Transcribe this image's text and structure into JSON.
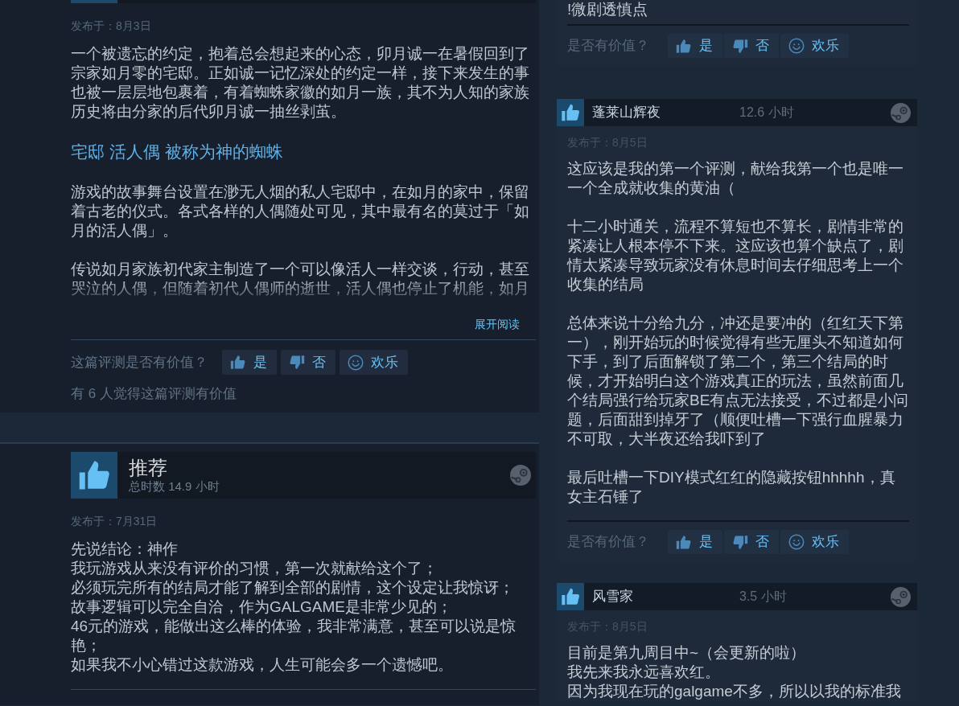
{
  "left_reviews": [
    {
      "posted": "发布于：8月3日",
      "body": [
        {
          "kind": "paragraph",
          "text": "一个被遗忘的约定，抱着总会想起来的心态，卯月诚一在暑假回到了宗家如月零的宅邸。正如诚一记忆深处的约定一样，接下来发生的事也被一层层地包裹着，有着蜘蛛家徽的如月一族，其不为人知的家族历史将由分家的后代卯月诚一抽丝剥茧。"
        },
        {
          "kind": "heading",
          "text": "宅邸 活人偶 被称为神的蜘蛛"
        },
        {
          "kind": "paragraph",
          "text": "游戏的故事舞台设置在渺无人烟的私人宅邸中，在如月的家中，保留着古老的仪式。各式各样的人偶随处可见，其中最有名的莫过于「如月的活人偶」。"
        },
        {
          "kind": "paragraph",
          "text": "传说如月家族初代家主制造了一个可以像活人一样交谈，行动，甚至哭泣的人偶，但随着初代人偶师的逝世，活人偶也停止了机能，如月"
        }
      ],
      "collapsed": true,
      "expand_link": "展开阅读",
      "helpful": {
        "question": "这篇评测是否有价值？",
        "buttons": [
          {
            "kind": "yes",
            "label": "是"
          },
          {
            "kind": "no",
            "label": "否"
          },
          {
            "kind": "funny",
            "label": "欢乐"
          }
        ]
      },
      "helpful_count": "有 6 人觉得这篇评测有价值"
    },
    {
      "recommended": true,
      "title": "推荐",
      "hours": "总时数 14.9 小时",
      "posted": "发布于：7月31日",
      "body": [
        {
          "kind": "paragraph",
          "text": "先说结论：神作"
        },
        {
          "kind": "line",
          "text": "我玩游戏从来没有评价的习惯，第一次就献给这个了；"
        },
        {
          "kind": "line",
          "text": "必须玩完所有的结局才能了解到全部的剧情，这个设定让我惊讶；"
        },
        {
          "kind": "line",
          "text": "故事逻辑可以完全自洽，作为GALGAME是非常少见的；"
        },
        {
          "kind": "line",
          "text": "46元的游戏，能做出这么棒的体验，我非常满意，甚至可以说是惊艳；"
        },
        {
          "kind": "line",
          "text": "如果我不小心错过这款游戏，人生可能会多一个遗憾吧。"
        }
      ]
    }
  ],
  "right_reviews": [
    {
      "body": [
        {
          "kind": "paragraph",
          "text": "!微剧透慎点"
        }
      ],
      "helpful": {
        "question": "是否有价值？",
        "buttons": [
          {
            "kind": "yes",
            "label": "是"
          },
          {
            "kind": "no",
            "label": "否"
          },
          {
            "kind": "funny",
            "label": "欢乐"
          }
        ]
      }
    },
    {
      "recommended": true,
      "author": "蓬莱山辉夜",
      "hours": "12.6 小时",
      "posted": "发布于：8月5日",
      "body": [
        {
          "kind": "paragraph",
          "text": "这应该是我的第一个评测，献给我第一个也是唯一一个全成就收集的黄油（"
        },
        {
          "kind": "paragraph",
          "text": "十二小时通关，流程不算短也不算长，剧情非常的紧凑让人根本停不下来。这应该也算个缺点了，剧情太紧凑导致玩家没有休息时间去仔细思考上一个收集的结局"
        },
        {
          "kind": "paragraph",
          "text": "总体来说十分给九分，冲还是要冲的（红红天下第一），刚开始玩的时候觉得有些无厘头不知道如何下手，到了后面解锁了第二个，第三个结局的时候，才开始明白这个游戏真正的玩法，虽然前面几个结局强行给玩家BE有点无法接受，不过都是小问题，后面甜到掉牙了（顺便吐槽一下强行血腥暴力不可取，大半夜还给我吓到了"
        },
        {
          "kind": "paragraph",
          "text": "最后吐槽一下DIY模式红红的隐藏按钮hhhhh，真女主石锤了"
        }
      ],
      "helpful": {
        "question": "是否有价值？",
        "buttons": [
          {
            "kind": "yes",
            "label": "是"
          },
          {
            "kind": "no",
            "label": "否"
          },
          {
            "kind": "funny",
            "label": "欢乐"
          }
        ]
      }
    },
    {
      "recommended": true,
      "author": "风雪家",
      "hours": "3.5 小时",
      "posted": "发布于：8月5日",
      "body": [
        {
          "kind": "paragraph",
          "text": "目前是第九周目中~（会更新的啦）"
        },
        {
          "kind": "line",
          "text": "我先来我永远喜欢红。"
        },
        {
          "kind": "line",
          "text": "因为我现在玩的galgame不多，所以以我的标准我"
        }
      ]
    }
  ]
}
